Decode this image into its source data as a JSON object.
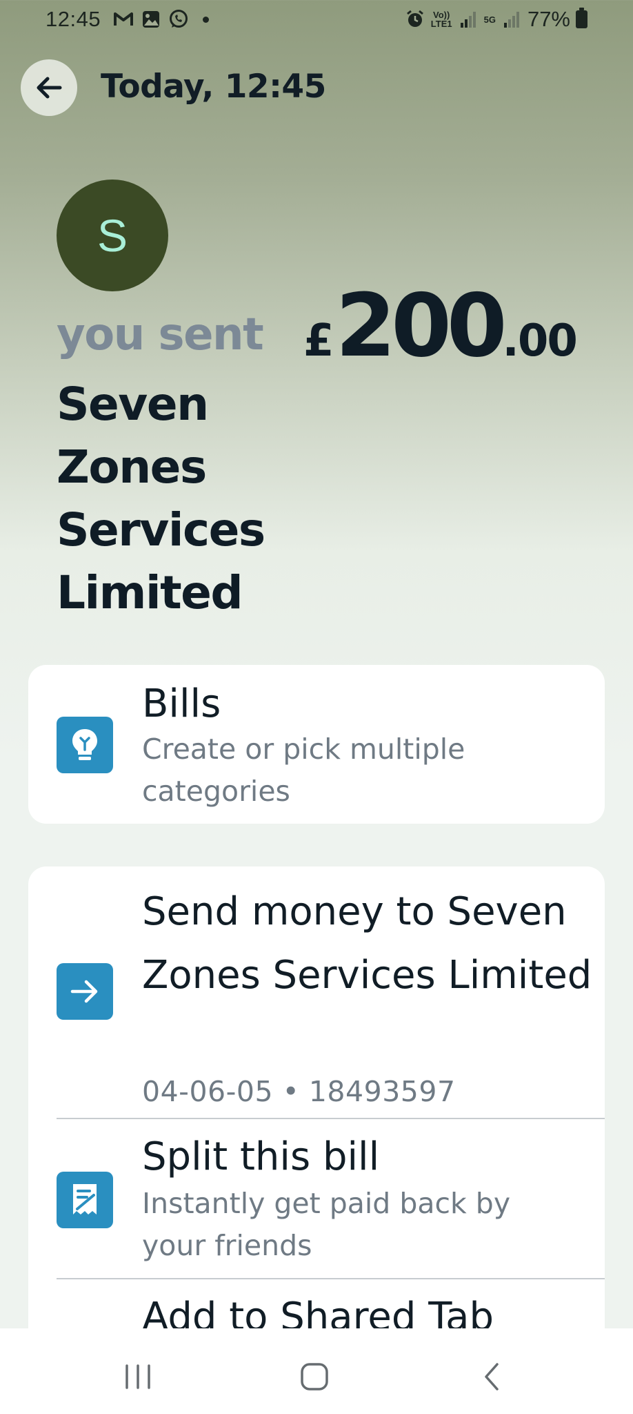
{
  "status_bar": {
    "time": "12:45",
    "left_icons": [
      "gmail-icon",
      "gallery-icon",
      "whatsapp-icon"
    ],
    "network_tag_top": "Vo))",
    "network_tag_bottom": "LTE1",
    "network_5g": "5G",
    "battery": "77%"
  },
  "header": {
    "title": "Today, 12:45"
  },
  "transaction": {
    "avatar_initial": "S",
    "direction_label": "you sent",
    "currency": "£",
    "amount_main": "200",
    "amount_decimal": ".00",
    "recipient": "Seven Zones Services Limited"
  },
  "category_card": {
    "title": "Bills",
    "subtitle": "Create or pick multiple categories",
    "icon": "lightbulb-icon"
  },
  "actions": {
    "send_money": {
      "title": "Send money to Seven Zones Services Limited",
      "details": "04-06-05 • 18493597",
      "icon": "arrow-right-icon"
    },
    "split_bill": {
      "title": "Split this bill",
      "subtitle": "Instantly get paid back by your friends",
      "icon": "receipt-icon"
    },
    "shared_tab": {
      "title": "Add to Shared Tab"
    }
  },
  "colors": {
    "accent": "#2a8fc0",
    "avatar_bg": "#3b4a25",
    "avatar_text": "#a9efd8",
    "muted_text": "#7c8996"
  }
}
